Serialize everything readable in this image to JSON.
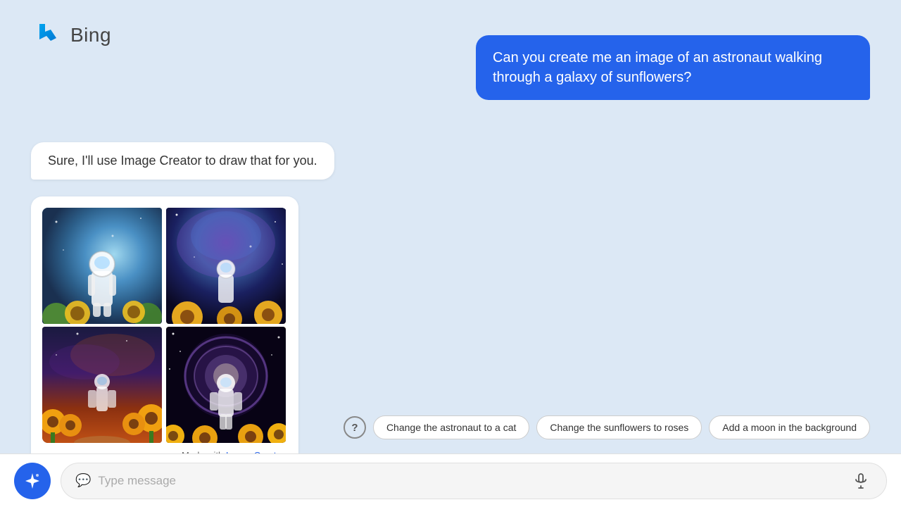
{
  "app": {
    "title": "Bing",
    "logo_text": "Bing"
  },
  "chat": {
    "user_message": "Can you create me an image of an astronaut walking through a galaxy of sunflowers?",
    "assistant_message": "Sure, I'll use Image Creator to draw that for you.",
    "made_with_text": "Made with ",
    "image_creator_label": "Image Creator"
  },
  "suggestions": {
    "help_label": "?",
    "chips": [
      {
        "id": "chip1",
        "label": "Change the astronaut to a cat"
      },
      {
        "id": "chip2",
        "label": "Change the sunflowers to roses"
      },
      {
        "id": "chip3",
        "label": "Add a moon in the background"
      }
    ]
  },
  "input": {
    "placeholder": "Type message",
    "value": ""
  },
  "images": {
    "description": "AI-generated images of astronaut in sunflower galaxy"
  }
}
